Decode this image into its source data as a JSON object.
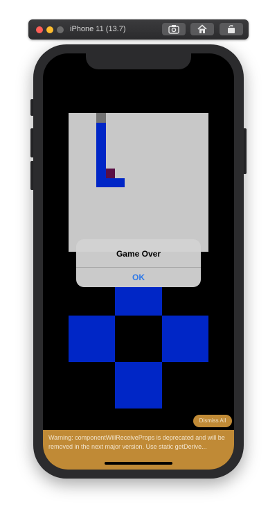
{
  "simulator": {
    "title": "iPhone 11 (13.7)",
    "buttons": [
      "screenshot-icon",
      "home-icon",
      "rotate-icon"
    ]
  },
  "alert": {
    "title": "Game Over",
    "ok_label": "OK"
  },
  "warning": {
    "dismiss_label": "Dismiss All",
    "message": "Warning: componentWillReceiveProps is deprecated and will be removed in the next major version. Use static getDerive..."
  },
  "colors": {
    "board": "#c8c8c8",
    "piece_blue": "#0026c6",
    "piece_gray": "#737373",
    "piece_purple": "#5a0f45",
    "warning_bg": "#c08a36",
    "alert_button": "#2f79e8"
  }
}
